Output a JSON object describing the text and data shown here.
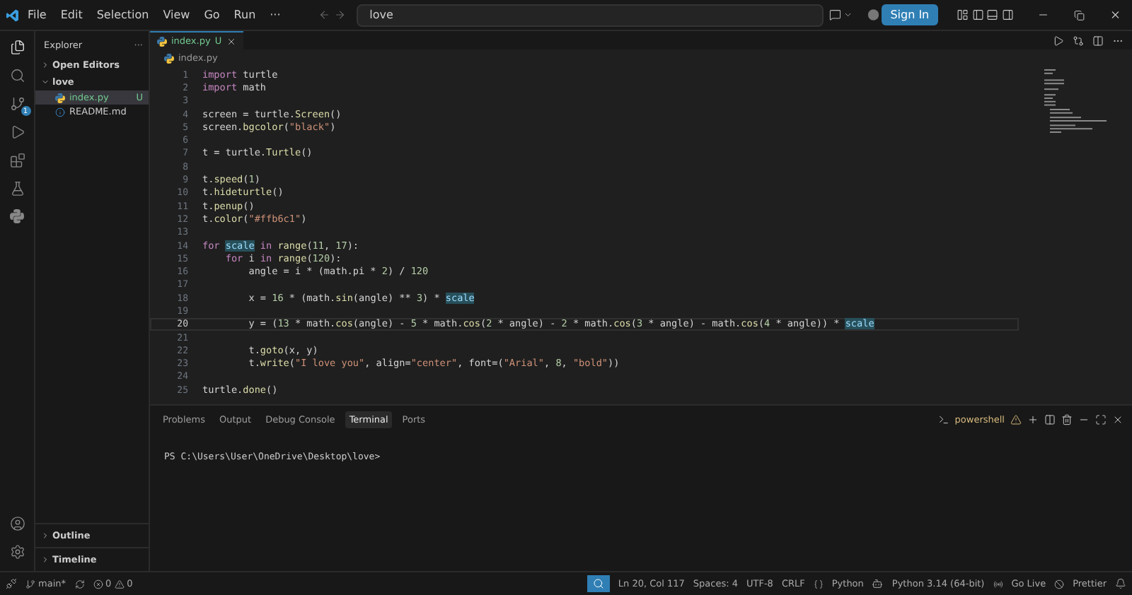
{
  "title_bar": {
    "menus": [
      "File",
      "Edit",
      "Selection",
      "View",
      "Go",
      "Run",
      "···"
    ],
    "search": {
      "value": "love"
    },
    "sign_in": "Sign In"
  },
  "sidebar": {
    "title": "Explorer",
    "more": "···",
    "sections": [
      {
        "label": "Open Editors",
        "expanded": false
      },
      {
        "label": "love",
        "expanded": true,
        "children": [
          {
            "label": "index.py",
            "badge": "U",
            "kind": "python",
            "selected": true
          },
          {
            "label": "README.md",
            "kind": "info",
            "selected": false
          }
        ]
      }
    ],
    "bottom_sections": [
      {
        "label": "Outline",
        "expanded": false
      },
      {
        "label": "Timeline",
        "expanded": false
      }
    ]
  },
  "activity_bar": {
    "source_control_badge": "1"
  },
  "editor": {
    "tabs": [
      {
        "label": "index.py",
        "badge": "U",
        "selected": true
      }
    ],
    "breadcrumb": "index.py",
    "lines": [
      {
        "number": "1",
        "current": false,
        "tokens": [
          {
            "kind": "k",
            "text": "import"
          },
          {
            "kind": "p",
            "text": " turtle"
          }
        ]
      },
      {
        "number": "2",
        "current": false,
        "tokens": [
          {
            "kind": "k",
            "text": "import"
          },
          {
            "kind": "p",
            "text": " math"
          }
        ]
      },
      {
        "number": "3",
        "current": false
      },
      {
        "number": "4",
        "current": false,
        "tokens": [
          {
            "kind": "p",
            "text": "screen = turtle."
          },
          {
            "kind": "f",
            "text": "Screen"
          },
          {
            "kind": "p",
            "text": "()"
          }
        ]
      },
      {
        "number": "5",
        "current": false,
        "tokens": [
          {
            "kind": "p",
            "text": "screen."
          },
          {
            "kind": "f",
            "text": "bgcolor"
          },
          {
            "kind": "p",
            "text": "("
          },
          {
            "kind": "s",
            "text": "\"black\""
          },
          {
            "kind": "p",
            "text": ")"
          }
        ]
      },
      {
        "number": "6",
        "current": false
      },
      {
        "number": "7",
        "current": false,
        "tokens": [
          {
            "kind": "p",
            "text": "t = turtle."
          },
          {
            "kind": "f",
            "text": "Turtle"
          },
          {
            "kind": "p",
            "text": "()"
          }
        ]
      },
      {
        "number": "8",
        "current": false
      },
      {
        "number": "9",
        "current": false,
        "tokens": [
          {
            "kind": "p",
            "text": "t."
          },
          {
            "kind": "f",
            "text": "speed"
          },
          {
            "kind": "p",
            "text": "("
          },
          {
            "kind": "n",
            "text": "1"
          },
          {
            "kind": "p",
            "text": ")"
          }
        ]
      },
      {
        "number": "10",
        "current": false,
        "tokens": [
          {
            "kind": "p",
            "text": "t."
          },
          {
            "kind": "f",
            "text": "hideturtle"
          },
          {
            "kind": "p",
            "text": "()"
          }
        ]
      },
      {
        "number": "11",
        "current": false,
        "tokens": [
          {
            "kind": "p",
            "text": "t."
          },
          {
            "kind": "f",
            "text": "penup"
          },
          {
            "kind": "p",
            "text": "()"
          }
        ]
      },
      {
        "number": "12",
        "current": false,
        "tokens": [
          {
            "kind": "p",
            "text": "t."
          },
          {
            "kind": "f",
            "text": "color"
          },
          {
            "kind": "p",
            "text": "("
          },
          {
            "kind": "s",
            "text": "\"#ffb6c1\""
          },
          {
            "kind": "p",
            "text": ")"
          }
        ]
      },
      {
        "number": "13",
        "current": false
      },
      {
        "number": "14",
        "current": false,
        "tokens": [
          {
            "kind": "k",
            "text": "for "
          },
          {
            "kind": "h",
            "text": "scale"
          },
          {
            "kind": "k",
            "text": " in "
          },
          {
            "kind": "f",
            "text": "range"
          },
          {
            "kind": "p",
            "text": "("
          },
          {
            "kind": "n",
            "text": "11"
          },
          {
            "kind": "p",
            "text": ", "
          },
          {
            "kind": "n",
            "text": "17"
          },
          {
            "kind": "p",
            "text": "):"
          }
        ]
      },
      {
        "number": "15",
        "current": false,
        "tokens": [
          {
            "kind": "k",
            "text": "    for"
          },
          {
            "kind": "p",
            "text": " i "
          },
          {
            "kind": "k",
            "text": "in "
          },
          {
            "kind": "f",
            "text": "range"
          },
          {
            "kind": "p",
            "text": "("
          },
          {
            "kind": "n",
            "text": "120"
          },
          {
            "kind": "p",
            "text": "):"
          }
        ]
      },
      {
        "number": "16",
        "current": false,
        "tokens": [
          {
            "kind": "p",
            "text": "        angle = i * (math.pi * "
          },
          {
            "kind": "n",
            "text": "2"
          },
          {
            "kind": "p",
            "text": ") / "
          },
          {
            "kind": "n",
            "text": "120"
          }
        ]
      },
      {
        "number": "17",
        "current": false
      },
      {
        "number": "18",
        "current": false,
        "tokens": [
          {
            "kind": "p",
            "text": "        x = "
          },
          {
            "kind": "n",
            "text": "16"
          },
          {
            "kind": "p",
            "text": " * (math."
          },
          {
            "kind": "f",
            "text": "sin"
          },
          {
            "kind": "p",
            "text": "(angle) ** "
          },
          {
            "kind": "n",
            "text": "3"
          },
          {
            "kind": "p",
            "text": ") * "
          },
          {
            "kind": "h",
            "text": "scale"
          }
        ]
      },
      {
        "number": "19",
        "current": false
      },
      {
        "number": "20",
        "current": true,
        "tokens": [
          {
            "kind": "p",
            "text": "        y = ("
          },
          {
            "kind": "n",
            "text": "13"
          },
          {
            "kind": "p",
            "text": " * math."
          },
          {
            "kind": "f",
            "text": "cos"
          },
          {
            "kind": "p",
            "text": "(angle) - "
          },
          {
            "kind": "n",
            "text": "5"
          },
          {
            "kind": "p",
            "text": " * math."
          },
          {
            "kind": "f",
            "text": "cos"
          },
          {
            "kind": "p",
            "text": "("
          },
          {
            "kind": "n",
            "text": "2"
          },
          {
            "kind": "p",
            "text": " * angle) - "
          },
          {
            "kind": "n",
            "text": "2"
          },
          {
            "kind": "p",
            "text": " * math."
          },
          {
            "kind": "f",
            "text": "cos"
          },
          {
            "kind": "p",
            "text": "("
          },
          {
            "kind": "n",
            "text": "3"
          },
          {
            "kind": "p",
            "text": " * angle) - math."
          },
          {
            "kind": "f",
            "text": "cos"
          },
          {
            "kind": "p",
            "text": "("
          },
          {
            "kind": "n",
            "text": "4"
          },
          {
            "kind": "p",
            "text": " * angle)) * "
          },
          {
            "kind": "h",
            "text": "scale"
          }
        ]
      },
      {
        "number": "21",
        "current": false
      },
      {
        "number": "22",
        "current": false,
        "tokens": [
          {
            "kind": "p",
            "text": "        t."
          },
          {
            "kind": "f",
            "text": "goto"
          },
          {
            "kind": "p",
            "text": "(x, y)"
          }
        ]
      },
      {
        "number": "23",
        "current": false,
        "tokens": [
          {
            "kind": "p",
            "text": "        t."
          },
          {
            "kind": "f",
            "text": "write"
          },
          {
            "kind": "p",
            "text": "("
          },
          {
            "kind": "s",
            "text": "\"I love you\""
          },
          {
            "kind": "p",
            "text": ", align="
          },
          {
            "kind": "s",
            "text": "\"center\""
          },
          {
            "kind": "p",
            "text": ", font=("
          },
          {
            "kind": "s",
            "text": "\"Arial\""
          },
          {
            "kind": "p",
            "text": ", "
          },
          {
            "kind": "n",
            "text": "8"
          },
          {
            "kind": "p",
            "text": ", "
          },
          {
            "kind": "s",
            "text": "\"bold\""
          },
          {
            "kind": "p",
            "text": "))"
          }
        ]
      },
      {
        "number": "24",
        "current": false
      },
      {
        "number": "25",
        "current": false,
        "tokens": [
          {
            "kind": "p",
            "text": "turtle."
          },
          {
            "kind": "f",
            "text": "done"
          },
          {
            "kind": "p",
            "text": "()"
          }
        ]
      }
    ]
  },
  "panel": {
    "tabs": [
      {
        "label": "Problems",
        "selected": false
      },
      {
        "label": "Output",
        "selected": false
      },
      {
        "label": "Debug Console",
        "selected": false
      },
      {
        "label": "Terminal",
        "selected": true
      },
      {
        "label": "Ports",
        "selected": false
      }
    ],
    "shell": "powershell",
    "terminal_text": "PS C:\\Users\\User\\OneDrive\\Desktop\\love>"
  },
  "status_bar": {
    "branch": "main*",
    "errors": "0",
    "warnings": "0",
    "right": [
      "Ln 20, Col 117",
      "Spaces: 4",
      "UTF-8",
      "CRLF",
      "Python",
      "Python 3.14 (64-bit)",
      "Go Live",
      "Prettier"
    ]
  }
}
